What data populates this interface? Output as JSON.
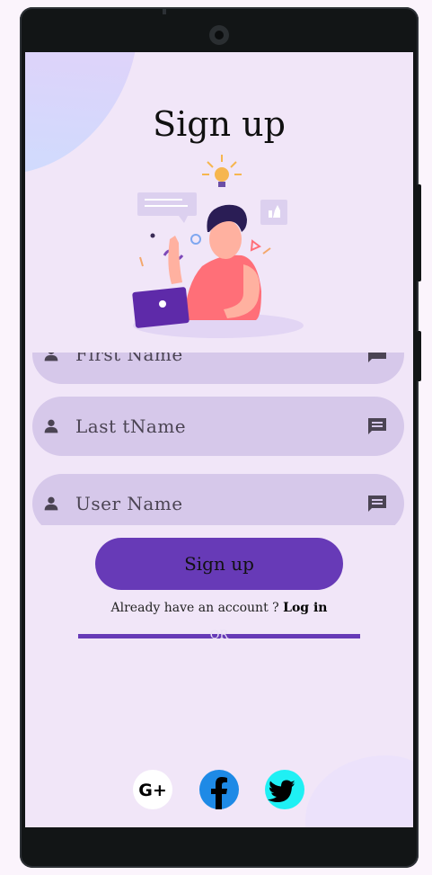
{
  "page": {
    "title": "Sign up"
  },
  "form": {
    "fields": [
      {
        "label": "First Name"
      },
      {
        "label": "Last tName"
      },
      {
        "label": "User Name"
      }
    ],
    "signup_button": "Sign up"
  },
  "account": {
    "prompt": "Already have an account ? ",
    "login_link": "Log in"
  },
  "divider": {
    "label": "OR"
  },
  "social": [
    {
      "name": "google-plus-icon",
      "text": "G+"
    },
    {
      "name": "facebook-icon"
    },
    {
      "name": "twitter-icon"
    }
  ],
  "colors": {
    "accent": "#673ab7",
    "field_bg": "#d6c8ea",
    "screen_bg": "#f1e6f8"
  }
}
